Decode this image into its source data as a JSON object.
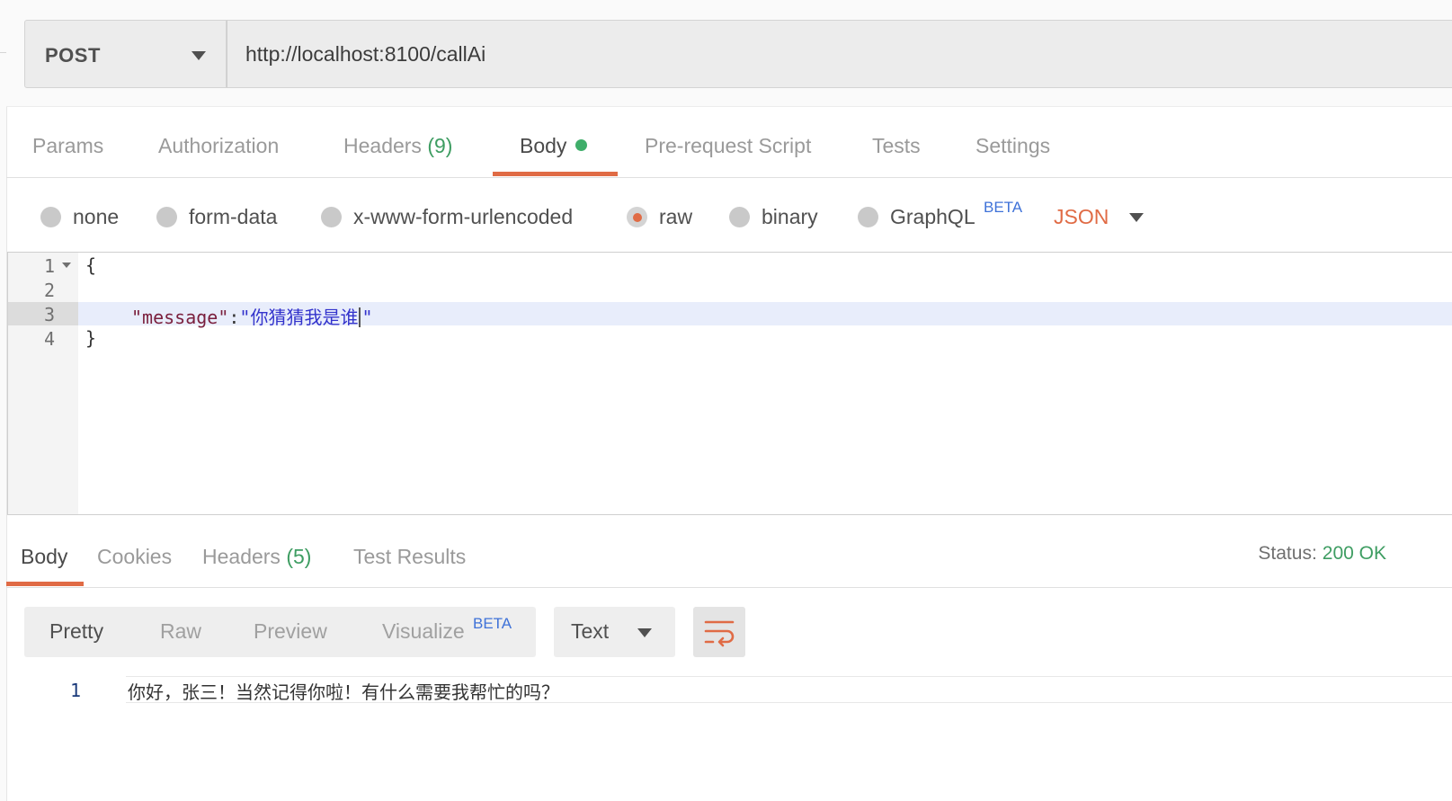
{
  "request": {
    "method": "POST",
    "url": "http://localhost:8100/callAi"
  },
  "request_tabs": {
    "params": "Params",
    "authorization": "Authorization",
    "headers": "Headers",
    "headers_count": "(9)",
    "body": "Body",
    "prerequest": "Pre-request Script",
    "tests": "Tests",
    "settings": "Settings"
  },
  "body_types": {
    "none": "none",
    "form_data": "form-data",
    "urlencoded": "x-www-form-urlencoded",
    "raw": "raw",
    "binary": "binary",
    "graphql": "GraphQL",
    "beta": "BETA",
    "selected": "raw",
    "format": "JSON"
  },
  "editor": {
    "line_numbers": [
      "1",
      "2",
      "3",
      "4"
    ],
    "open_brace": "{",
    "key": "\"message\"",
    "colon": ":",
    "value_before_cursor": "\"你猜猜我是谁",
    "value_after_cursor": "\"",
    "close_brace": "}"
  },
  "response_tabs": {
    "body": "Body",
    "cookies": "Cookies",
    "headers": "Headers",
    "headers_count": "(5)",
    "test_results": "Test Results"
  },
  "status": {
    "label": "Status:",
    "value": "200 OK"
  },
  "view_modes": {
    "pretty": "Pretty",
    "raw": "Raw",
    "preview": "Preview",
    "visualize": "Visualize",
    "beta": "BETA",
    "format": "Text"
  },
  "response": {
    "line_number": "1",
    "text": "你好，张三！当然记得你啦！有什么需要我帮忙的吗？"
  },
  "colors": {
    "accent": "#e06b45",
    "success": "#3e9d62",
    "beta": "#3f72d8"
  },
  "icons": {
    "method_dropdown": "chevron-down-icon",
    "body_indicator": "green-dot-icon",
    "format_dropdown": "chevron-down-icon",
    "wrap": "word-wrap-icon",
    "fold": "fold-triangle-icon"
  }
}
